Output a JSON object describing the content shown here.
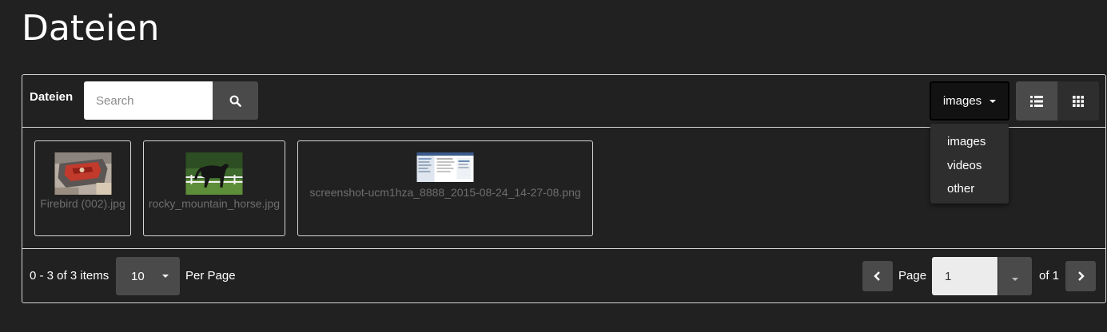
{
  "page": {
    "title": "Dateien"
  },
  "toolbar": {
    "label": "Dateien",
    "search_placeholder": "Search",
    "filter_selected": "images",
    "filter_options": [
      "images",
      "videos",
      "other"
    ],
    "icons": {
      "search": "search-icon",
      "list_view": "list-view-icon",
      "grid_view": "grid-view-icon"
    }
  },
  "files": [
    {
      "name": "Firebird (002).jpg",
      "thumbnail": "car-door-photo"
    },
    {
      "name": "rocky_mountain_horse.jpg",
      "thumbnail": "horse-photo"
    },
    {
      "name": "screenshot-ucm1hza_8888_2015-08-24_14-27-08.png",
      "thumbnail": "screenshot-image"
    }
  ],
  "footer": {
    "items_count": "0 - 3 of 3 items",
    "per_page_value": "10",
    "per_page_label": "Per Page",
    "page_label": "Page",
    "page_value": "1",
    "of_label": "of 1"
  },
  "colors": {
    "background": "#212121",
    "border": "#d6d6d6",
    "button": "#4a4a4a",
    "muted_text": "#6e6e6e"
  }
}
